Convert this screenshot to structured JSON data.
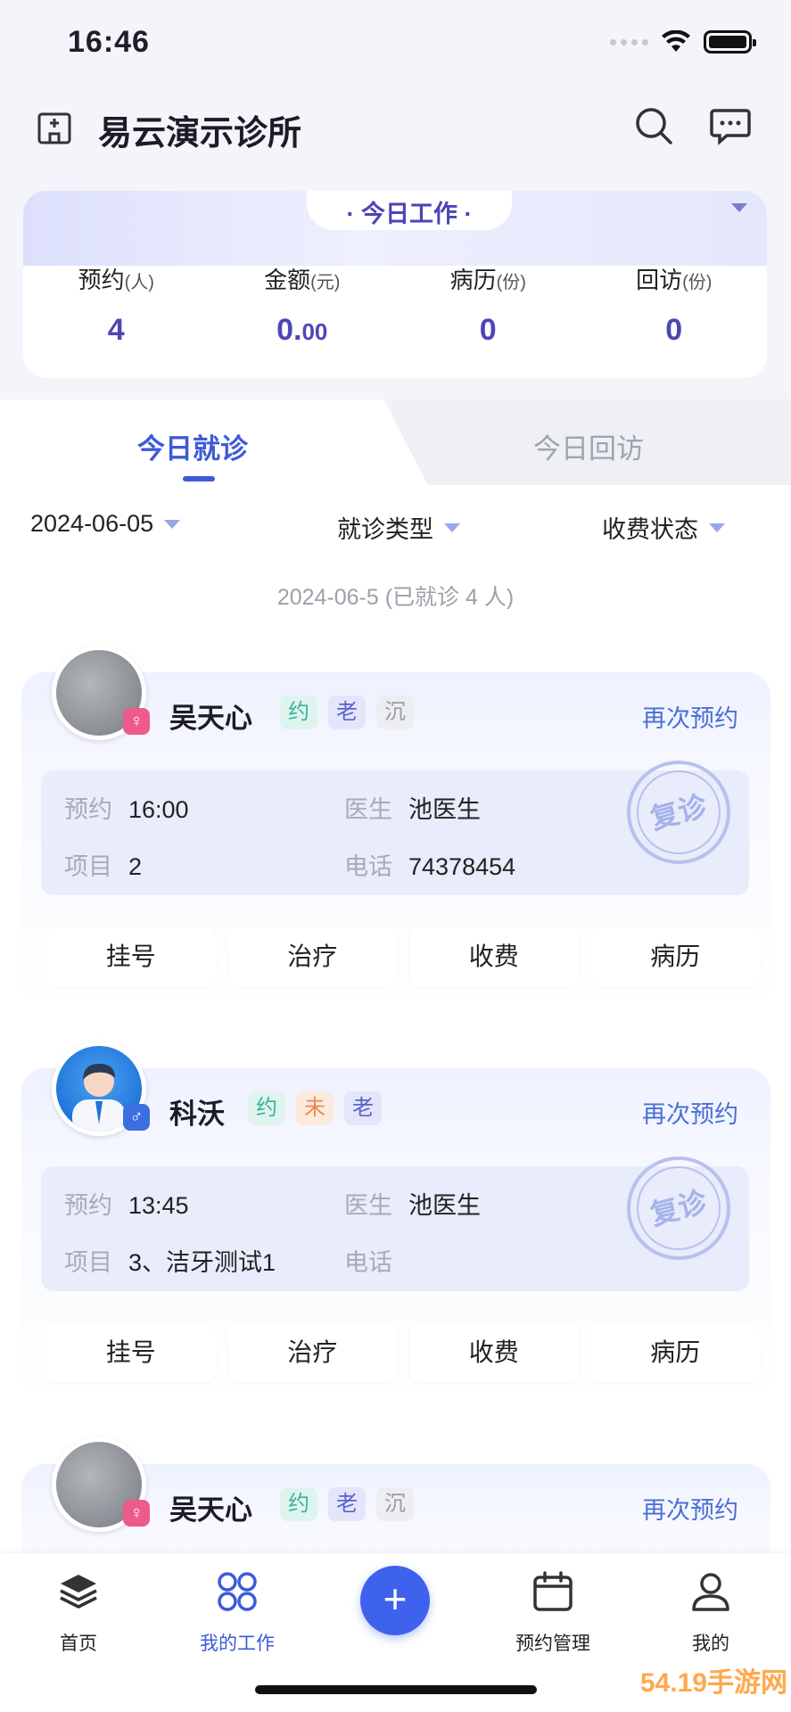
{
  "status": {
    "time": "16:46"
  },
  "header": {
    "clinic_name": "易云演示诊所"
  },
  "work": {
    "title": "· 今日工作 ·",
    "stats": [
      {
        "label": "预约",
        "unit": "(人)",
        "value_int": "4",
        "value_dec": ""
      },
      {
        "label": "金额",
        "unit": "(元)",
        "value_int": "0.",
        "value_dec": "00"
      },
      {
        "label": "病历",
        "unit": "(份)",
        "value_int": "0",
        "value_dec": ""
      },
      {
        "label": "回访",
        "unit": "(份)",
        "value_int": "0",
        "value_dec": ""
      }
    ]
  },
  "tabs": {
    "visit": "今日就诊",
    "return": "今日回访"
  },
  "filters": {
    "date": "2024-06-05",
    "type": "就诊类型",
    "fee": "收费状态"
  },
  "summary": "2024-06-5 (已就诊 4 人)",
  "patients": [
    {
      "name": "吴天心",
      "gender": "♀",
      "badges": [
        "约",
        "老",
        "沉"
      ],
      "rebook": "再次预约",
      "appt_label": "预约",
      "appt": "16:00",
      "doctor_label": "医生",
      "doctor": "池医生",
      "item_label": "项目",
      "item": "2",
      "phone_label": "电话",
      "phone": "74378454",
      "stamp": "复诊",
      "actions": [
        "挂号",
        "治疗",
        "收费",
        "病历"
      ]
    },
    {
      "name": "科沃",
      "gender": "♂",
      "badges": [
        "约",
        "未",
        "老"
      ],
      "rebook": "再次预约",
      "appt_label": "预约",
      "appt": "13:45",
      "doctor_label": "医生",
      "doctor": "池医生",
      "item_label": "项目",
      "item": "3、洁牙测试1",
      "phone_label": "电话",
      "phone": "",
      "stamp": "复诊",
      "actions": [
        "挂号",
        "治疗",
        "收费",
        "病历"
      ]
    },
    {
      "name": "吴天心",
      "gender": "♀",
      "badges": [
        "约",
        "老",
        "沉"
      ],
      "rebook": "再次预约"
    }
  ],
  "nav": {
    "home": "首页",
    "mywork": "我的工作",
    "add": "+",
    "appointments": "预约管理",
    "me": "我的"
  },
  "watermark": "54.19手游网",
  "colors": {
    "accent": "#3d5bd8",
    "primary_button": "#3f62ec",
    "stat_value": "#4d47b5"
  }
}
